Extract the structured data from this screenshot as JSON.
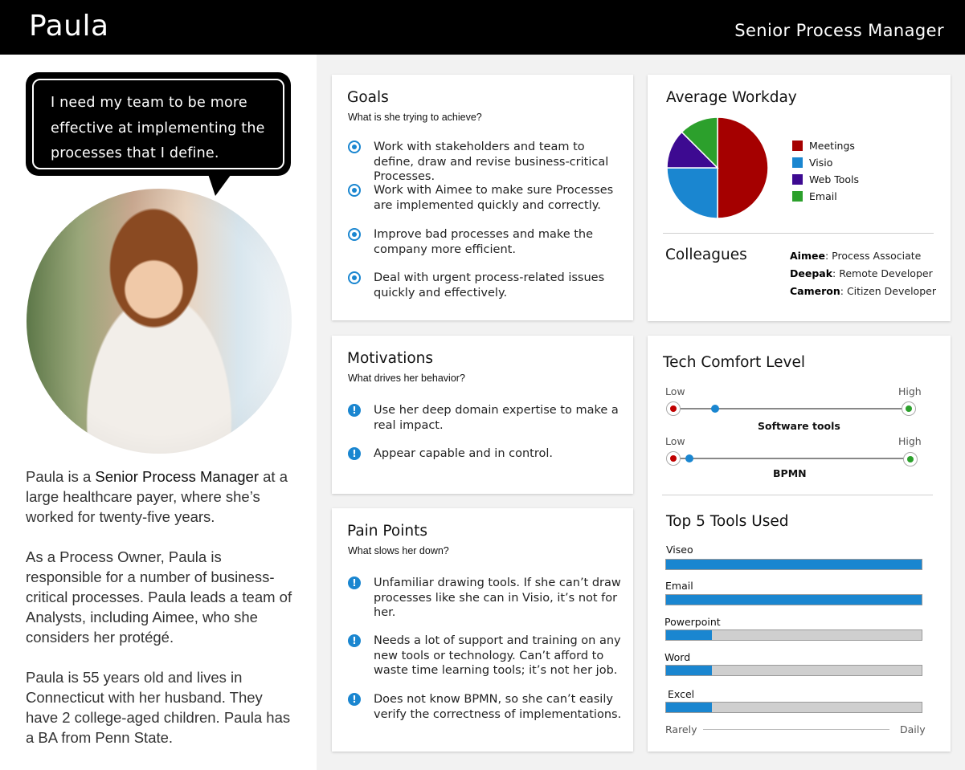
{
  "header": {
    "name": "Paula",
    "role": "Senior Process Manager"
  },
  "quote": "I need my team to be more effective at implementing the processes that I define.",
  "bio": {
    "p1_prefix": "Paula is a ",
    "p1_highlight": "Senior Process Manager",
    "p1_suffix": " at a large healthcare payer, where she’s worked for twenty-five years.",
    "p2": "As a Process Owner, Paula is responsible for a number of business-critical processes. Paula leads a team of Analysts, including Aimee, who she considers her protégé.",
    "p3": "Paula is 55 years old and lives in Connecticut with her husband. They have 2 college-aged children. Paula has a BA from Penn State."
  },
  "goals": {
    "title": "Goals",
    "subtitle": "What is she trying to achieve?",
    "items": [
      "Work with stakeholders and team to define, draw and revise business-critical Processes.",
      "Work with Aimee to make sure Processes are implemented quickly and correctly.",
      "Improve bad processes and make the company more efficient.",
      "Deal with urgent process-related issues quickly and effectively."
    ]
  },
  "motivations": {
    "title": "Motivations",
    "subtitle": "What drives her behavior?",
    "items": [
      "Use her deep domain expertise to make a real impact.",
      "Appear capable and in control."
    ]
  },
  "pain_points": {
    "title": "Pain Points",
    "subtitle": "What slows her down?",
    "items": [
      "Unfamiliar drawing tools. If she can’t draw processes like she can in Visio, it’s not for her.",
      "Needs a lot of support and training on any new tools or technology. Can’t afford to waste time learning tools; it’s not her job.",
      "Does not know BPMN, so she can’t easily verify the correctness of implementations."
    ]
  },
  "workday": {
    "title": "Average Workday",
    "legend": [
      {
        "label": "Meetings",
        "color": "#a50000"
      },
      {
        "label": "Visio",
        "color": "#1a86d0"
      },
      {
        "label": "Web Tools",
        "color": "#3d0a91"
      },
      {
        "label": "Email",
        "color": "#2ca02c"
      }
    ]
  },
  "chart_data": {
    "type": "pie",
    "title": "Average Workday",
    "labels": [
      "Meetings",
      "Visio",
      "Web Tools",
      "Email"
    ],
    "values": [
      50,
      25,
      12.5,
      12.5
    ],
    "colors": [
      "#a50000",
      "#1a86d0",
      "#3d0a91",
      "#2ca02c"
    ],
    "legend": "right"
  },
  "colleagues": {
    "title": "Colleagues",
    "items": [
      {
        "name": "Aimee",
        "role": ": Process Associate"
      },
      {
        "name": "Deepak",
        "role": ": Remote Developer"
      },
      {
        "name": "Cameron",
        "role": ": Citizen Developer"
      }
    ]
  },
  "tech_comfort": {
    "title": "Tech Comfort Level",
    "low_label": "Low",
    "high_label": "High",
    "scales": [
      {
        "name": "Software tools",
        "level": 0.18
      },
      {
        "name": "BPMN",
        "level": 0.07
      }
    ]
  },
  "top_tools": {
    "title": "Top 5 Tools Used",
    "axis_low": "Rarely",
    "axis_high": "Daily",
    "tools": [
      {
        "name": "Viseo",
        "level": 1.0
      },
      {
        "name": "Email",
        "level": 1.0
      },
      {
        "name": "Powerpoint",
        "level": 0.18
      },
      {
        "name": "Word",
        "level": 0.18
      },
      {
        "name": "Excel",
        "level": 0.18
      }
    ]
  }
}
